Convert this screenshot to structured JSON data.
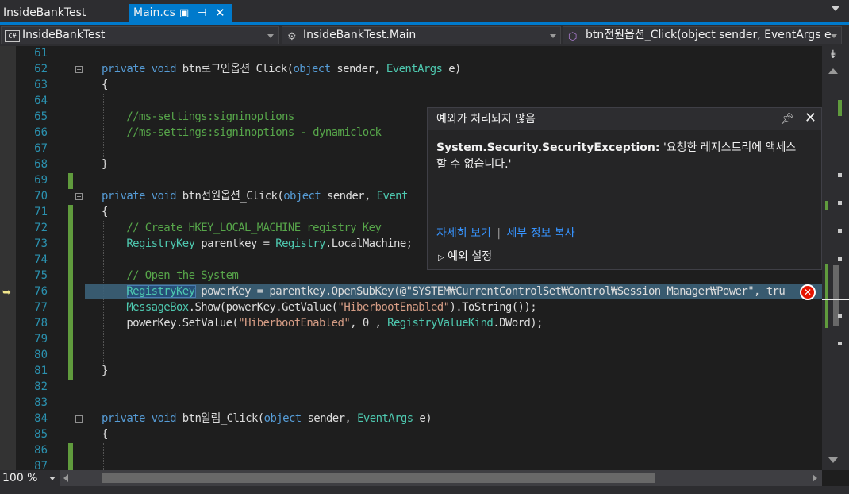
{
  "tabs": {
    "solution": "InsideBankTest",
    "file": "Main.cs"
  },
  "nav": {
    "project": "InsideBankTest",
    "class": "InsideBankTest.Main",
    "member": "btn전원옵션_Click(object sender, EventArgs e"
  },
  "lines": [
    {
      "n": "61",
      "t": []
    },
    {
      "n": "62",
      "t": [
        [
          "kw",
          "private void "
        ],
        [
          "",
          "btn로그인옵션_Click("
        ],
        [
          "kw",
          "object"
        ],
        [
          "",
          " sender, "
        ],
        [
          "ty",
          "EventArgs"
        ],
        [
          "",
          " e)"
        ]
      ]
    },
    {
      "n": "63",
      "t": [
        [
          "",
          "{"
        ]
      ]
    },
    {
      "n": "64",
      "t": []
    },
    {
      "n": "65",
      "t": [
        [
          "cm",
          "    //ms-settings:signinoptions"
        ]
      ]
    },
    {
      "n": "66",
      "t": [
        [
          "cm",
          "    //ms-settings:signinoptions - dynamiclock"
        ]
      ]
    },
    {
      "n": "67",
      "t": []
    },
    {
      "n": "68",
      "t": [
        [
          "",
          "}"
        ]
      ]
    },
    {
      "n": "69",
      "t": []
    },
    {
      "n": "70",
      "t": [
        [
          "kw",
          "private void "
        ],
        [
          "",
          "btn전원옵션_Click("
        ],
        [
          "kw",
          "object"
        ],
        [
          "",
          " sender, "
        ],
        [
          "ty",
          "Event"
        ]
      ]
    },
    {
      "n": "71",
      "t": [
        [
          "",
          "{"
        ]
      ]
    },
    {
      "n": "72",
      "t": [
        [
          "cm",
          "    // Create HKEY_LOCAL_MACHINE registry Key"
        ]
      ]
    },
    {
      "n": "73",
      "t": [
        [
          "",
          "    "
        ],
        [
          "ty",
          "RegistryKey"
        ],
        [
          "",
          " parentkey = "
        ],
        [
          "ty",
          "Registry"
        ],
        [
          "",
          ".LocalMachine;"
        ]
      ]
    },
    {
      "n": "74",
      "t": []
    },
    {
      "n": "75",
      "t": [
        [
          "cm",
          "    // Open the System"
        ]
      ]
    },
    {
      "n": "76",
      "t": [
        [
          "",
          "    "
        ],
        [
          "ty",
          "RegistryKey"
        ],
        [
          "",
          " powerKey = parentkey.OpenSubKey(@\"SYSTEM₩CurrentControlSet₩Control₩Session Manager₩Power\", tru"
        ]
      ]
    },
    {
      "n": "77",
      "t": [
        [
          "",
          "    "
        ],
        [
          "ty",
          "MessageBox"
        ],
        [
          "",
          ".Show(powerKey.GetValue("
        ],
        [
          "st",
          "\"HiberbootEnabled\""
        ],
        [
          "",
          ").ToString());"
        ]
      ]
    },
    {
      "n": "78",
      "t": [
        [
          "",
          "    powerKey.SetValue("
        ],
        [
          "st",
          "\"HiberbootEnabled\""
        ],
        [
          "",
          ", 0 , "
        ],
        [
          "ty",
          "RegistryValueKind"
        ],
        [
          "",
          ".DWord);"
        ]
      ]
    },
    {
      "n": "79",
      "t": []
    },
    {
      "n": "80",
      "t": []
    },
    {
      "n": "81",
      "t": [
        [
          "",
          "}"
        ]
      ]
    },
    {
      "n": "82",
      "t": []
    },
    {
      "n": "83",
      "t": []
    },
    {
      "n": "84",
      "t": [
        [
          "kw",
          "private void "
        ],
        [
          "",
          "btn알림_Click("
        ],
        [
          "kw",
          "object"
        ],
        [
          "",
          " sender, "
        ],
        [
          "ty",
          "EventArgs"
        ],
        [
          "",
          " e)"
        ]
      ]
    },
    {
      "n": "85",
      "t": [
        [
          "",
          "{"
        ]
      ]
    },
    {
      "n": "86",
      "t": []
    },
    {
      "n": "87",
      "t": []
    }
  ],
  "exception": {
    "title": "예외가 처리되지 않음",
    "type": "System.Security.SecurityException:",
    "message": "'요청한 레지스트리에 액세스할 수 없습니다.'",
    "link_details": "자세히 보기",
    "link_copy": "세부 정보 복사",
    "settings": "예외 설정"
  },
  "zoom": "100 %",
  "colors": {
    "accent": "#007acc",
    "change_bar": "#609b3d",
    "error": "#e51400"
  }
}
